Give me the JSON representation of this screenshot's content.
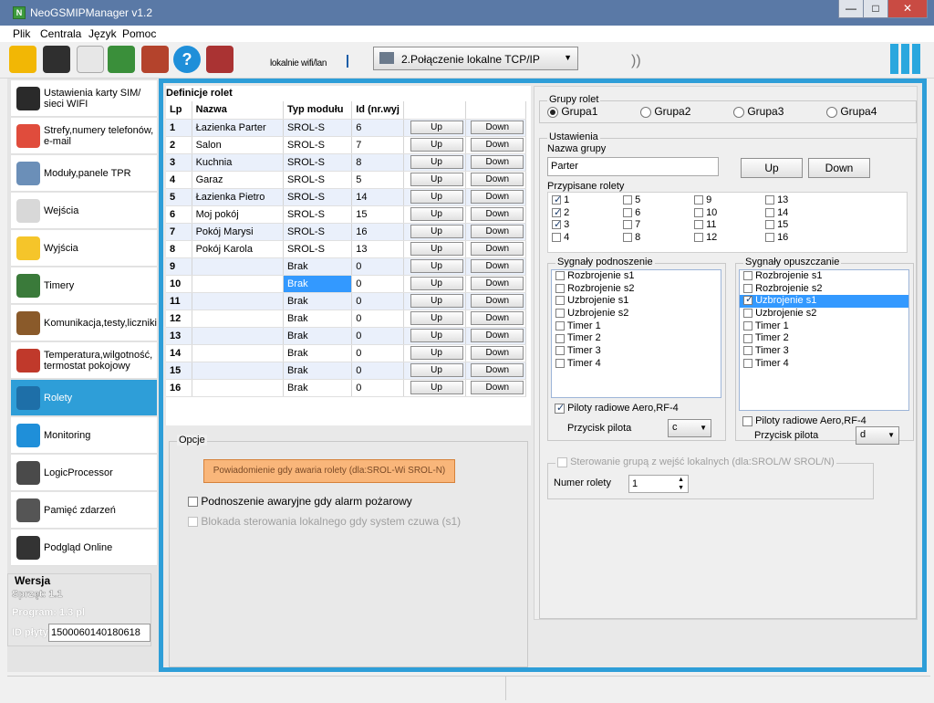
{
  "window": {
    "title": "NeoGSMIPManager v1.2",
    "min": "—",
    "max": "□",
    "close": "✕"
  },
  "menu": [
    "Plik",
    "Centrala",
    "Język",
    "Pomoc"
  ],
  "toolbar": {
    "conn_mode": "lokalnie wifi/lan",
    "connection": "2.Połączenie lokalne TCP/IP"
  },
  "sidebar": {
    "items": [
      {
        "label": "Ustawienia karty SIM/ sieci WIFI",
        "icon": "sim-card-icon"
      },
      {
        "label": "Strefy,numery telefonów, e-mail",
        "icon": "zones-icon"
      },
      {
        "label": "Moduły,panele TPR",
        "icon": "modules-icon"
      },
      {
        "label": "Wejścia",
        "icon": "inputs-icon"
      },
      {
        "label": "Wyjścia",
        "icon": "outputs-icon"
      },
      {
        "label": "Timery",
        "icon": "clock-icon"
      },
      {
        "label": "Komunikacja,testy,liczniki",
        "icon": "tools-icon"
      },
      {
        "label": "Temperatura,wilgotność, termostat pokojowy",
        "icon": "thermometer-icon"
      },
      {
        "label": "Rolety",
        "icon": "blinds-icon"
      },
      {
        "label": "Monitoring",
        "icon": "monitoring-icon"
      },
      {
        "label": "LogicProcessor",
        "icon": "logic-icon"
      },
      {
        "label": "Pamięć zdarzeń",
        "icon": "events-icon"
      },
      {
        "label": "Podgląd Online",
        "icon": "online-icon"
      }
    ],
    "version": {
      "title": "Wersja",
      "hw": "Sprzęt: 1.1",
      "prog": "Program: 1.3 pl",
      "id_label": "ID płyty",
      "id_value": "1500060140180618"
    }
  },
  "table": {
    "title": "Definicje rolet",
    "headers": [
      "Lp",
      "Nazwa",
      "Typ modułu",
      "Id (nr.wyj"
    ],
    "up": "Up",
    "down": "Down",
    "rows": [
      [
        "1",
        "Łazienka Parter",
        "SROL-S",
        "6"
      ],
      [
        "2",
        "Salon",
        "SROL-S",
        "7"
      ],
      [
        "3",
        "Kuchnia",
        "SROL-S",
        "8"
      ],
      [
        "4",
        "Garaz",
        "SROL-S",
        "5"
      ],
      [
        "5",
        "Łazienka Pietro",
        "SROL-S",
        "14"
      ],
      [
        "6",
        "Moj pokój",
        "SROL-S",
        "15"
      ],
      [
        "7",
        "Pokój Marysi",
        "SROL-S",
        "16"
      ],
      [
        "8",
        "Pokój Karola",
        "SROL-S",
        "13"
      ],
      [
        "9",
        "",
        "Brak",
        "0"
      ],
      [
        "10",
        "",
        "Brak",
        "0"
      ],
      [
        "11",
        "",
        "Brak",
        "0"
      ],
      [
        "12",
        "",
        "Brak",
        "0"
      ],
      [
        "13",
        "",
        "Brak",
        "0"
      ],
      [
        "14",
        "",
        "Brak",
        "0"
      ],
      [
        "15",
        "",
        "Brak",
        "0"
      ],
      [
        "16",
        "",
        "Brak",
        "0"
      ]
    ]
  },
  "options": {
    "title": "Opcje",
    "notify_btn": "Powiadomienie gdy awaria rolety  (dla:SROL-Wi SROL-N)",
    "fire": "Podnoszenie awaryjne gdy alarm pożarowy",
    "block": "Blokada sterowania lokalnego gdy system czuwa (s1)"
  },
  "groups": {
    "title": "Grupy rolet",
    "items": [
      "Grupa1",
      "Grupa2",
      "Grupa3",
      "Grupa4"
    ]
  },
  "settings": {
    "title": "Ustawienia",
    "name_label": "Nazwa grupy",
    "name_value": "Parter",
    "up": "Up",
    "down": "Down",
    "assigned": "Przypisane rolety",
    "raise_title": "Sygnały podnoszenie",
    "lower_title": "Sygnały opuszczanie",
    "signals": [
      "Rozbrojenie s1",
      "Rozbrojenie s2",
      "Uzbrojenie s1",
      "Uzbrojenie s2",
      "Timer 1",
      "Timer 2",
      "Timer 3",
      "Timer 4"
    ],
    "remote": "Piloty radiowe Aero,RF-4",
    "remote_btn_label": "Przycisk pilota",
    "remote_left": "c",
    "remote_right": "d",
    "local_title": "Sterowanie grupą z wejść lokalnych (dla:SROL/W SROL/N)",
    "num_label": "Numer rolety",
    "num_value": "1"
  }
}
